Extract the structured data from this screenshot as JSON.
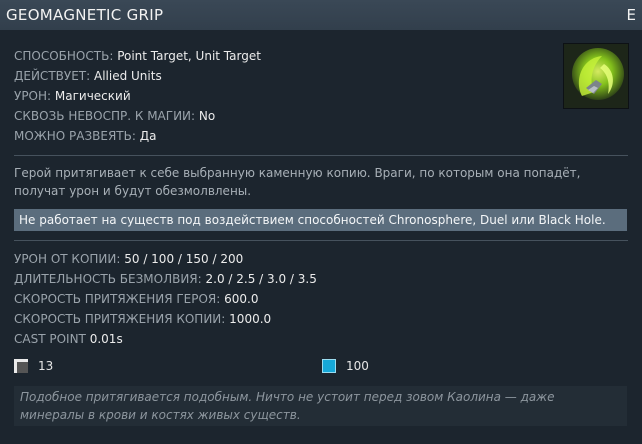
{
  "header": {
    "title": "GEOMAGNETIC GRIP",
    "hotkey": "E"
  },
  "icon": "geomagnetic-grip-ability-icon",
  "stats": [
    {
      "label": "СПОСОБНОСТЬ:",
      "value": "Point Target, Unit Target"
    },
    {
      "label": "ДЕЙСТВУЕТ:",
      "value": "Allied Units"
    },
    {
      "label": "УРОН:",
      "value": "Магический"
    },
    {
      "label": "СКВОЗЬ НЕВОСПР. К МАГИИ:",
      "value": "No"
    },
    {
      "label": "МОЖНО РАЗВЕЯТЬ:",
      "value": "Да"
    }
  ],
  "description": "Герой притягивает к себе выбранную каменную копию. Враги, по которым она попадёт, получат урон и будут обезмолвлены.",
  "note": "Не работает на существ под воздействием способностей Chronosphere, Duel или Black Hole.",
  "attributes": [
    {
      "label": "УРОН ОТ КОПИИ:",
      "value": "50 / 100 / 150 / 200"
    },
    {
      "label": "ДЛИТЕЛЬНОСТЬ БЕЗМОЛВИЯ:",
      "value": "2.0 / 2.5 / 3.0 / 3.5"
    },
    {
      "label": "СКОРОСТЬ ПРИТЯЖЕНИЯ ГЕРОЯ:",
      "value": "600.0"
    },
    {
      "label": "СКОРОСТЬ ПРИТЯЖЕНИЯ КОПИИ:",
      "value": "1000.0"
    },
    {
      "label": "CAST POINT",
      "value": "0.01s"
    }
  ],
  "costs": {
    "cooldown": "13",
    "mana": "100"
  },
  "lore": "Подобное притягивается подобным. Ничто не устоит перед зовом Каолина — даже минералы в крови и костях живых существ.",
  "colors": {
    "background": "#1c252e",
    "header": "#36434f",
    "note_bg": "#5b6d7d",
    "mana": "#16a8d8"
  }
}
